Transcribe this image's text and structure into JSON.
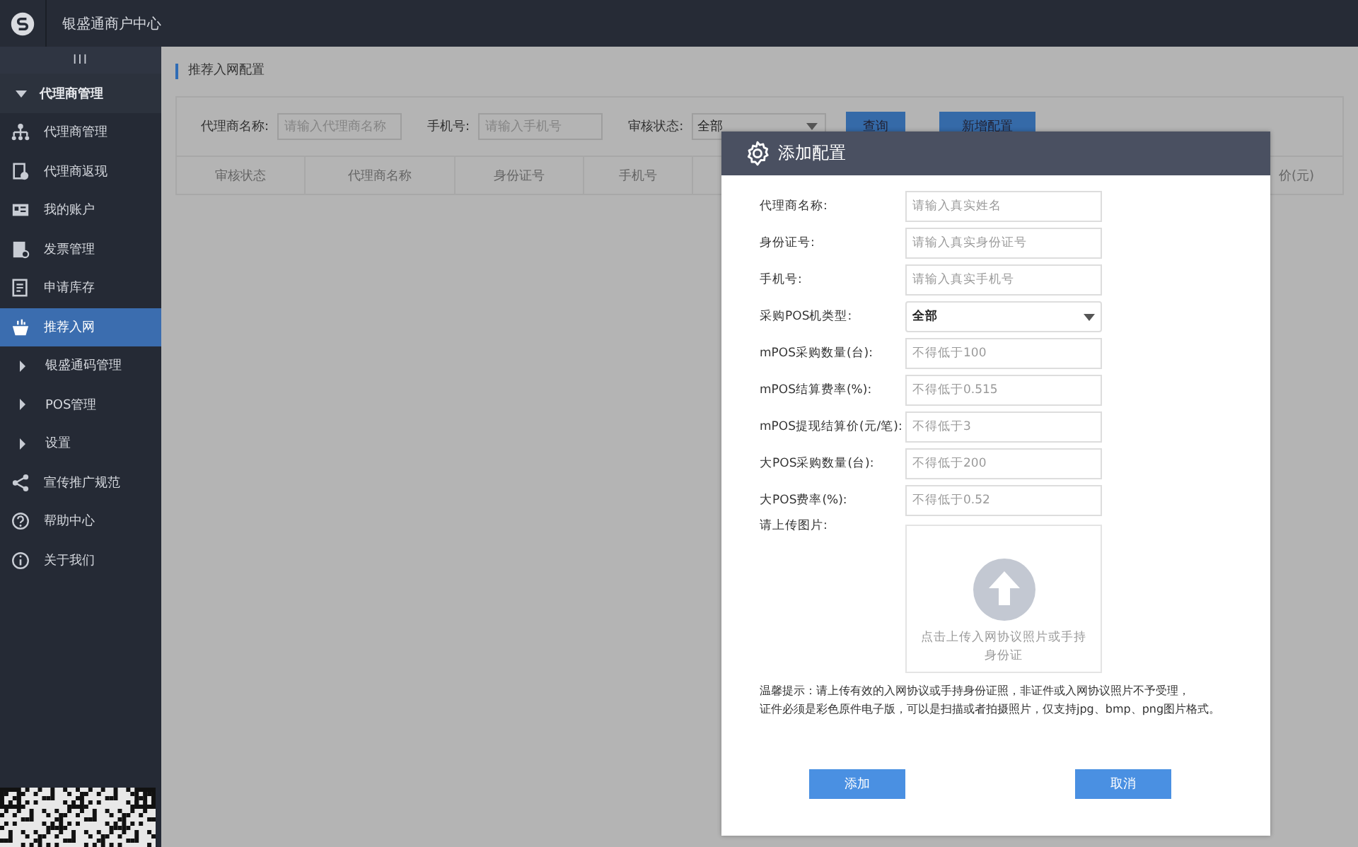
{
  "header": {
    "title": "银盛通商户中心"
  },
  "sidebar": {
    "toggle": "III",
    "group": {
      "label": "代理商管理",
      "expanded": true
    },
    "items": [
      {
        "label": "代理商管理",
        "kind": "link",
        "selected": false
      },
      {
        "label": "代理商返现",
        "kind": "link",
        "selected": false
      },
      {
        "label": "我的账户",
        "kind": "link",
        "selected": false
      },
      {
        "label": "发票管理",
        "kind": "link",
        "selected": false
      },
      {
        "label": "申请库存",
        "kind": "link",
        "selected": false
      },
      {
        "label": "推荐入网",
        "kind": "link",
        "selected": true
      },
      {
        "label": "银盛通码管理",
        "kind": "submenu",
        "expanded": false
      },
      {
        "label": "POS管理",
        "kind": "submenu",
        "expanded": false
      },
      {
        "label": "设置",
        "kind": "submenu",
        "expanded": false
      },
      {
        "label": "宣传推广规范",
        "kind": "link",
        "selected": false
      },
      {
        "label": "帮助中心",
        "kind": "link",
        "selected": false
      },
      {
        "label": "关于我们",
        "kind": "link",
        "selected": false
      }
    ]
  },
  "page": {
    "breadcrumb": "推荐入网配置",
    "filters": [
      {
        "label": "代理商名称:",
        "kind": "input",
        "placeholder": "请输入代理商名称"
      },
      {
        "label": "手机号:",
        "kind": "input",
        "placeholder": "请输入手机号"
      },
      {
        "label": "审核状态:",
        "kind": "select",
        "value": "全部"
      }
    ],
    "buttons": [
      "查询",
      "新增配置"
    ],
    "table": {
      "columns": [
        "审核状态",
        "代理商名称",
        "身份证号",
        "手机号",
        "价(元)"
      ]
    }
  },
  "dialog": {
    "title": "添加配置",
    "fields": [
      {
        "label": "代理商名称:",
        "kind": "input",
        "placeholder": "请输入真实姓名"
      },
      {
        "label": "身份证号:",
        "kind": "input",
        "placeholder": "请输入真实身份证号"
      },
      {
        "label": "手机号:",
        "kind": "input",
        "placeholder": "请输入真实手机号"
      },
      {
        "label": "采购POS机类型:",
        "kind": "select",
        "value": "全部"
      },
      {
        "label": "mPOS采购数量(台):",
        "kind": "input",
        "placeholder": "不得低于100"
      },
      {
        "label": "mPOS结算费率(%):",
        "kind": "input",
        "placeholder": "不得低于0.515"
      },
      {
        "label": "mPOS提现结算价(元/笔):",
        "kind": "input",
        "placeholder": "不得低于3"
      },
      {
        "label": "大POS采购数量(台):",
        "kind": "input",
        "placeholder": "不得低于200"
      },
      {
        "label": "大POS费率(%):",
        "kind": "input",
        "placeholder": "不得低于0.52"
      }
    ],
    "upload": {
      "label": "请上传图片:",
      "hint": "点击上传入网协议照片或手持身份证"
    },
    "tips": [
      "温馨提示：请上传有效的入网协议或手持身份证照，非证件或入网协议照片不予受理，",
      "证件必须是彩色原件电子版，可以是扫描或者拍摄照片，仅支持jpg、bmp、png图片格式。"
    ],
    "buttons": [
      "添加",
      "取消"
    ]
  }
}
